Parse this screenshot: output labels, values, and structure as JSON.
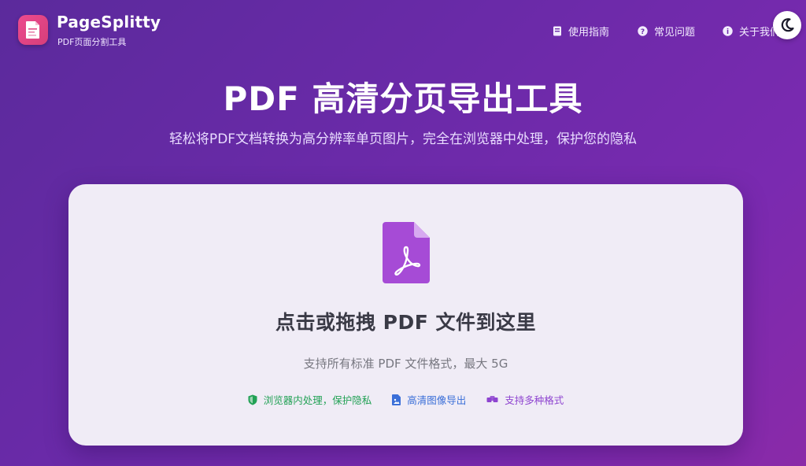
{
  "brand": {
    "name": "PageSplitty",
    "subtitle": "PDF页面分割工具"
  },
  "nav": {
    "items": [
      {
        "label": "使用指南",
        "icon": "book-icon"
      },
      {
        "label": "常见问题",
        "icon": "question-icon"
      },
      {
        "label": "关于我们",
        "icon": "info-icon"
      }
    ],
    "theme_toggle_icon": "moon-icon"
  },
  "hero": {
    "title": "PDF 高清分页导出工具",
    "subtitle": "轻松将PDF文档转换为高分辨率单页图片，完全在浏览器中处理，保护您的隐私"
  },
  "dropzone": {
    "icon": "pdf-file-icon",
    "title": "点击或拖拽 PDF 文件到这里",
    "hint": "支持所有标准 PDF 文件格式，最大 5G",
    "features": [
      {
        "label": "浏览器内处理，保护隐私",
        "icon": "shield-icon",
        "color": "#22a155"
      },
      {
        "label": "高清图像导出",
        "icon": "image-file-icon",
        "color": "#3b6fd8"
      },
      {
        "label": "支持多种格式",
        "icon": "layers-icon",
        "color": "#8e44d0"
      }
    ]
  },
  "colors": {
    "background_gradient_start": "#5b2a9c",
    "background_gradient_end": "#8a2aa8",
    "accent_pink": "#ec4b8e",
    "pdf_icon_purple": "#a64bd6",
    "card_background": "#f0ecf6"
  }
}
